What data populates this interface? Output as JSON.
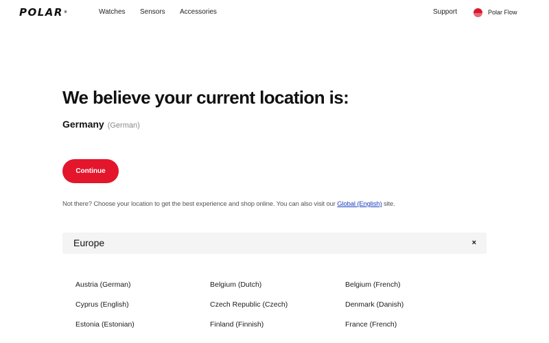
{
  "header": {
    "logo_text": "POLAR",
    "logo_mark": "®",
    "nav": [
      "Watches",
      "Sensors",
      "Accessories"
    ],
    "support_label": "Support",
    "flow_label": "Polar Flow",
    "flow_icon": "polar-flow-icon"
  },
  "main": {
    "headline": "We believe your current location is:",
    "country": "Germany",
    "language": "(German)",
    "continue_label": "Continue",
    "info_prefix": "Not there? Choose your location to get the best experience and shop online. You can also visit our ",
    "info_link": "Global (English)",
    "info_suffix": " site."
  },
  "region": {
    "title": "Europe",
    "close_label": "×",
    "countries": [
      "Austria (German)",
      "Belgium (Dutch)",
      "Belgium (French)",
      "Cyprus (English)",
      "Czech Republic (Czech)",
      "Denmark (Danish)",
      "Estonia (Estonian)",
      "Finland (Finnish)",
      "France (French)"
    ]
  },
  "colors": {
    "accent": "#e3162c",
    "link": "#1a3fbf",
    "region_bar": "#f4f4f4"
  }
}
